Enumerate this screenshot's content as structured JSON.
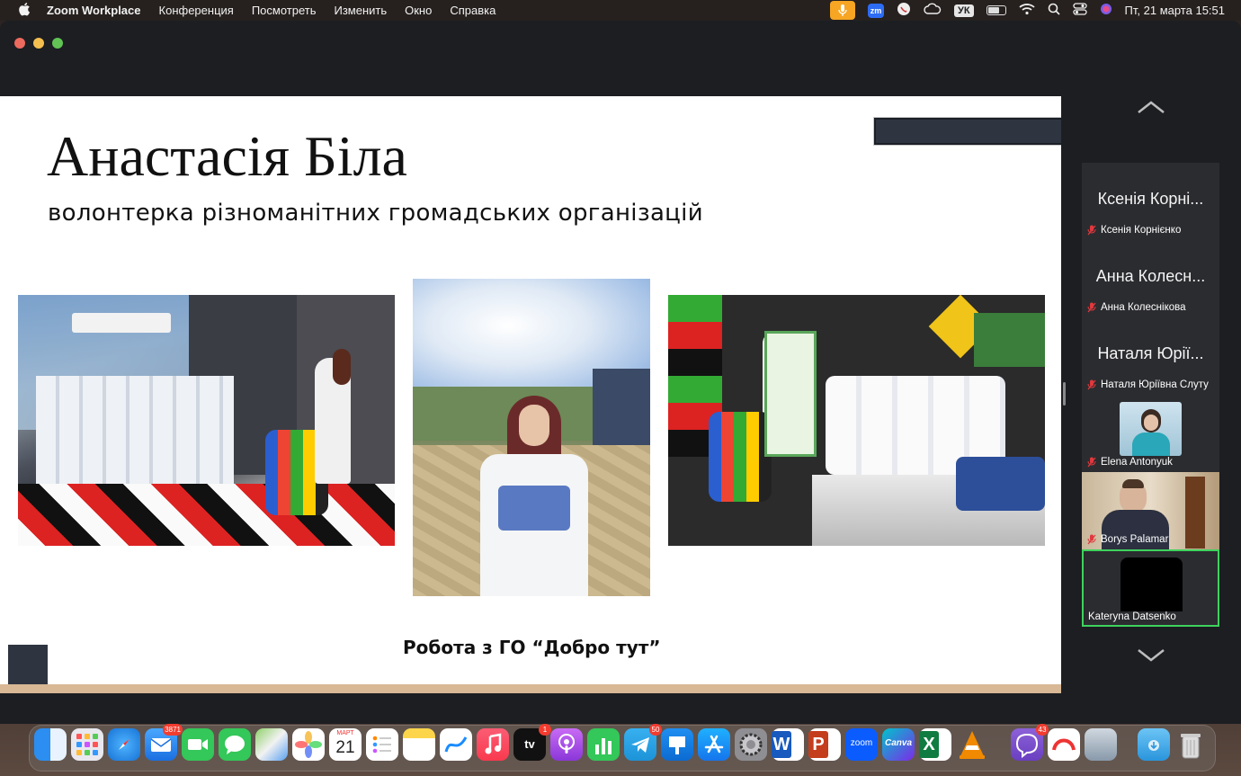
{
  "menubar": {
    "app_name": "Zoom Workplace",
    "items": [
      "Конференция",
      "Посмотреть",
      "Изменить",
      "Окно",
      "Справка"
    ],
    "keyboard_layout": "УК",
    "clock": "Пт, 21 марта  15:51",
    "zm_label": "zm"
  },
  "slide": {
    "title": "Анастасія Біла",
    "subtitle": "волонтерка різноманітних громадських організацій",
    "caption": "Робота з ГО “Добро тут”"
  },
  "participants": [
    {
      "display": "Ксенія Корні...",
      "name": "Ксенія Корнієнко",
      "muted": true,
      "video": false
    },
    {
      "display": "Анна Колесн...",
      "name": "Анна Колеснікова",
      "muted": true,
      "video": false
    },
    {
      "display": "Наталя Юрії...",
      "name": "Наталя Юріївна Слуту",
      "muted": true,
      "video": false
    },
    {
      "display": "",
      "name": "Elena Antonyuk",
      "muted": true,
      "video": true
    },
    {
      "display": "",
      "name": "Borys Palamar",
      "muted": true,
      "video": true
    },
    {
      "display": "",
      "name": "Kateryna Datsenko",
      "muted": false,
      "video": true,
      "active_speaker": true
    }
  ],
  "dock": {
    "mail_badge": "3871",
    "tv_badge": "1",
    "telegram_badge": "50",
    "viber_badge": "43",
    "calendar_month": "МАРТ",
    "calendar_day": "21",
    "tv_label": "tv",
    "zoom_label": "zoom",
    "canva_label": "Canva",
    "word_label": "W",
    "ppt_label": "P",
    "excel_label": "X"
  },
  "colors": {
    "active_speaker_border": "#3fd25d",
    "muted_icon": "#e0393e",
    "slide_band": "#d8b895",
    "slide_dark": "#2f3540"
  }
}
